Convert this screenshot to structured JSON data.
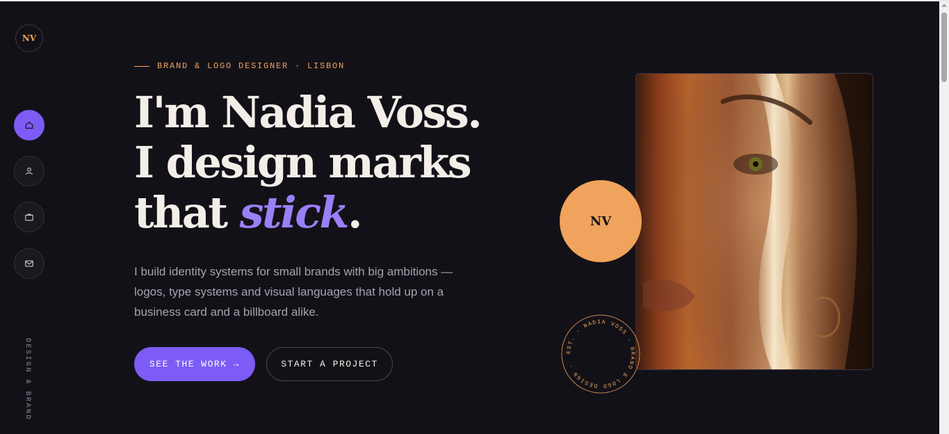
{
  "brand": {
    "logo_text": "NV"
  },
  "sidebar": {
    "items": [
      {
        "name": "home",
        "icon": "home-icon",
        "active": true
      },
      {
        "name": "about",
        "icon": "user-icon",
        "active": false
      },
      {
        "name": "work",
        "icon": "briefcase-icon",
        "active": false
      },
      {
        "name": "contact",
        "icon": "mail-icon",
        "active": false
      }
    ],
    "vertical_text": "DESIGN & BRAND"
  },
  "hero": {
    "eyebrow": "BRAND & LOGO DESIGNER · LISBON",
    "headline": {
      "line1": "I'm Nadia Voss.",
      "line2": "I design marks",
      "line3_prefix": "that ",
      "line3_accent": "stick",
      "line3_suffix": "."
    },
    "description": "I build identity systems for small brands with big ambitions — logos, type systems and visual languages that hold up on a business card and a billboard alike.",
    "primary_button": "SEE THE WORK →",
    "secondary_button": "START A PROJECT"
  },
  "badge": {
    "text": "NV"
  },
  "stamp": {
    "text": "EST. · NADIA VOSS · BRAND & LOGO DESIGN · "
  },
  "colors": {
    "background": "#131118",
    "accent_purple": "#7c5cf5",
    "accent_orange": "#f0a35c",
    "text_light": "#f3efe8"
  }
}
